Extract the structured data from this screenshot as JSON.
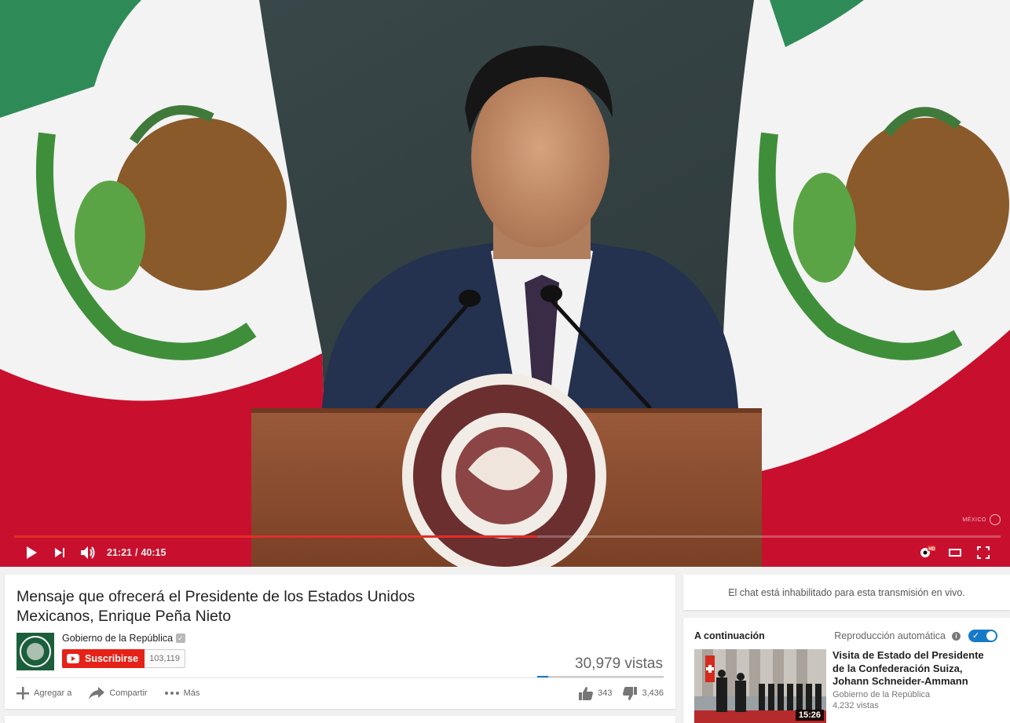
{
  "player": {
    "current_time": "21:21",
    "separator": "/",
    "duration": "40:15",
    "progress_fraction": 0.53,
    "loaded_fraction": 0.53,
    "watermark_text": "MÉXICO",
    "progress_color": "#e52d27"
  },
  "video": {
    "title": "Mensaje que ofrecerá el Presidente de los Estados Unidos Mexicanos, Enrique Peña Nieto",
    "channel": "Gobierno de la República",
    "subscribe_label": "Suscribirse",
    "subscriber_count": "103,119",
    "views": "30,979 vistas",
    "likes": "343",
    "dislikes": "3,436",
    "like_ratio": 0.09,
    "actions": {
      "add": "Agregar a",
      "share": "Compartir",
      "more": "Más"
    }
  },
  "sidebar": {
    "chat_disabled": "El chat está inhabilitado para esta transmisión en vivo.",
    "up_next": "A continuación",
    "autoplay": "Reproducción automática",
    "autoplay_on": true,
    "next_video": {
      "title": "Visita de Estado del Presidente de la Confederación Suiza, Johann Schneider-Ammann",
      "channel": "Gobierno de la República",
      "views": "4,232 vistas",
      "duration": "15:26"
    }
  },
  "colors": {
    "accent_red": "#e62117",
    "accent_blue": "#167ac6",
    "flag_green": "#2e8b57",
    "flag_red": "#c8102e"
  }
}
